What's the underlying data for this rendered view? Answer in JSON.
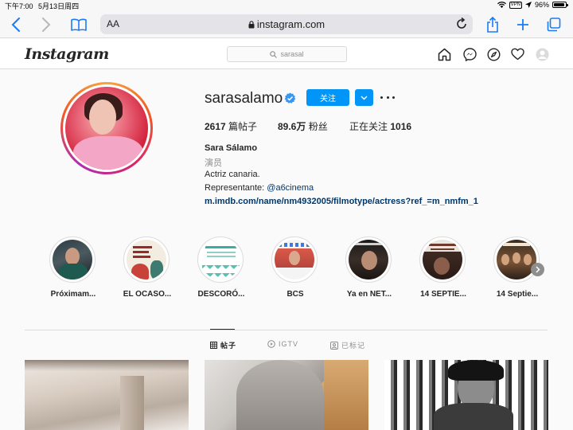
{
  "status_bar": {
    "time": "下午7:00",
    "date": "5月13日周四",
    "vpn": "VPN",
    "battery": "96%"
  },
  "browser": {
    "text_size_label": "AA",
    "url": "instagram.com"
  },
  "instagram": {
    "logo": "Instagram",
    "search_text": "sarasal"
  },
  "profile": {
    "username": "sarasalamo",
    "follow_label": "关注",
    "posts_count": "2617",
    "posts_label": "篇帖子",
    "followers_count": "89.6万",
    "followers_label": "粉丝",
    "following_label": "正在关注",
    "following_count": "1016",
    "full_name": "Sara Sálamo",
    "category": "演员",
    "bio_line1": "Actriz canaria.",
    "bio_line2_prefix": "Representante: ",
    "bio_mention": "@a6cinema",
    "bio_link": "m.imdb.com/name/nm4932005/filmotype/actress?ref_=m_nmfm_1"
  },
  "highlights": [
    {
      "label": "Próximam..."
    },
    {
      "label": "EL OCASO..."
    },
    {
      "label": "DESCORÓ..."
    },
    {
      "label": "BCS"
    },
    {
      "label": "Ya en NET..."
    },
    {
      "label": "14 SEPTIE..."
    },
    {
      "label": "14 Septie..."
    }
  ],
  "tabs": [
    {
      "label": "帖子",
      "active": true
    },
    {
      "label": "IGTV",
      "active": false
    },
    {
      "label": "已标记",
      "active": false
    }
  ],
  "colors": {
    "accent": "#0095f6",
    "safari_blue": "#1a7cf5"
  }
}
